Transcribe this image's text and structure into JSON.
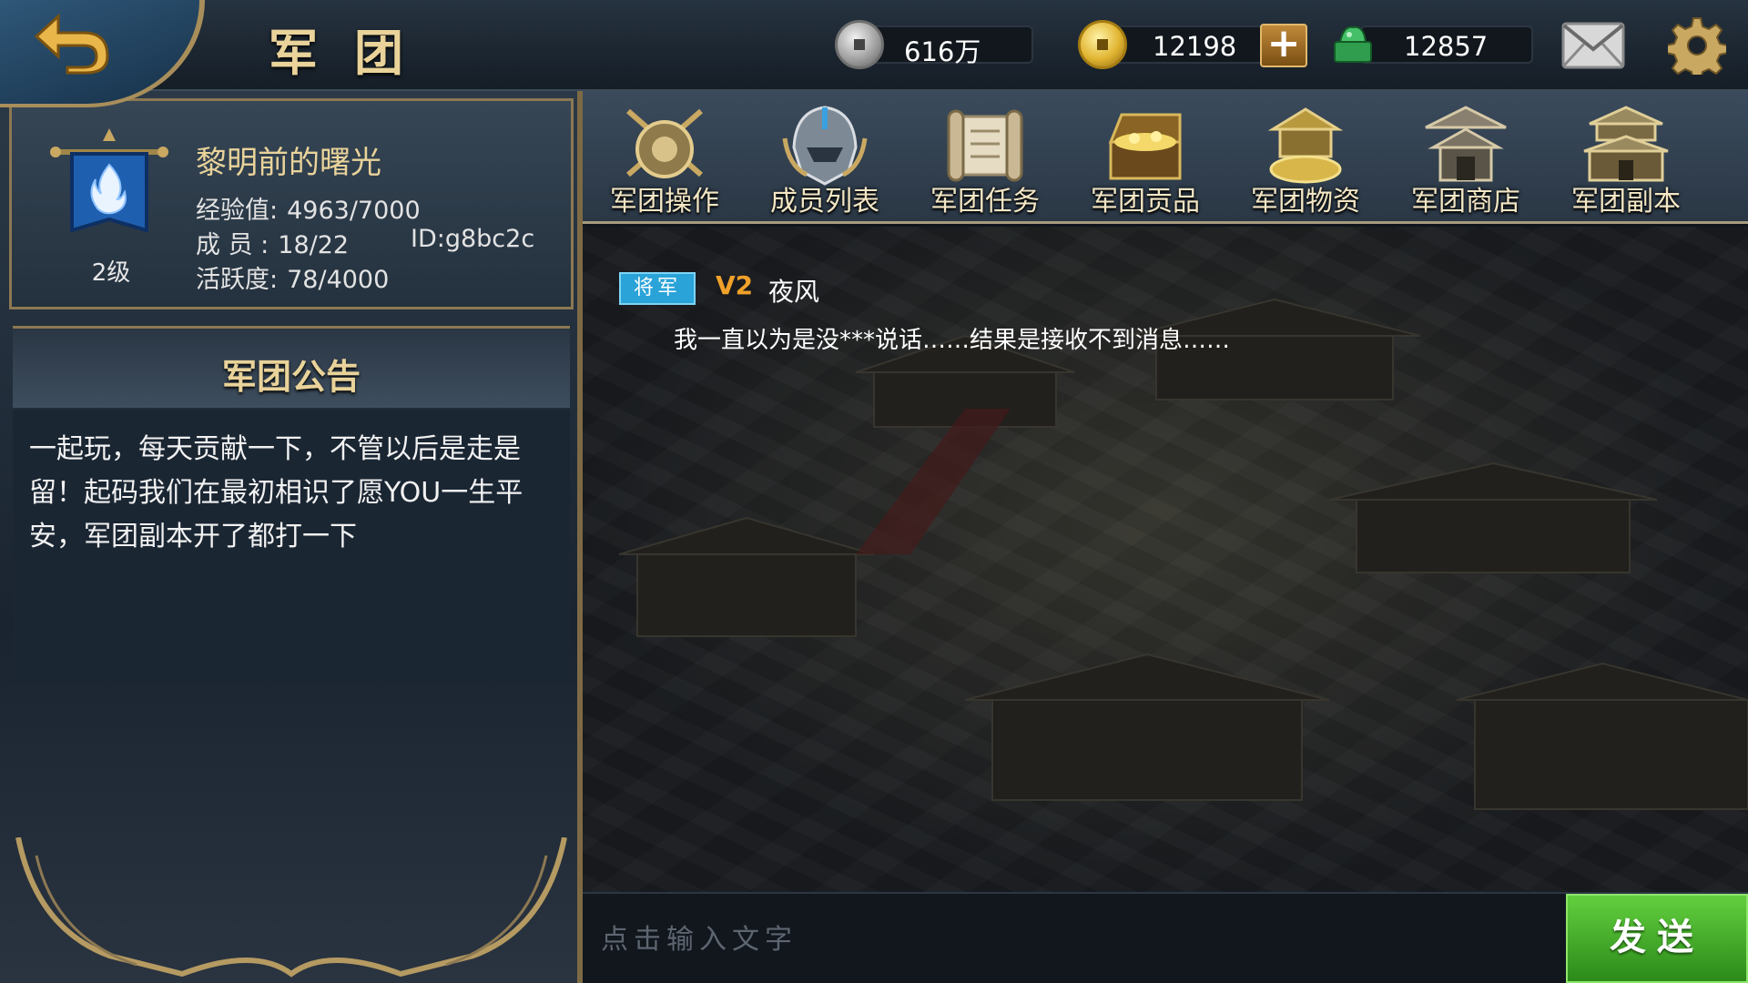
{
  "header": {
    "title": "军团",
    "back_icon": "back-arrow-icon"
  },
  "resources": {
    "silver": "616万",
    "gold": "12198",
    "jade": "12857",
    "add_label": "+"
  },
  "guild": {
    "name": "黎明前的曙光",
    "level": "2级",
    "exp_label": "经验值:",
    "exp_value": "4963/7000",
    "members_label": "成  员 :",
    "members_value": "18/22",
    "id": "ID:g8bc2c",
    "activity_label": "活跃度:",
    "activity_value": "78/4000"
  },
  "notice": {
    "title": "军团公告",
    "text": "一起玩，每天贡献一下，不管以后是走是留！起码我们在最初相识了愿YOU一生平安，军团副本开了都打一下"
  },
  "tabs": [
    {
      "label": "军团操作",
      "icon": "shield-swords-icon"
    },
    {
      "label": "成员列表",
      "icon": "helmet-icon"
    },
    {
      "label": "军团任务",
      "icon": "scroll-icon"
    },
    {
      "label": "军团贡品",
      "icon": "treasure-chest-icon"
    },
    {
      "label": "军团物资",
      "icon": "warehouse-icon"
    },
    {
      "label": "军团商店",
      "icon": "shop-pavilion-icon"
    },
    {
      "label": "军团副本",
      "icon": "palace-icon"
    }
  ],
  "chat": {
    "messages": [
      {
        "rank": "将军",
        "vip": "V2",
        "sender": "夜风",
        "text": "我一直以为是没***说话……结果是接收不到消息……"
      }
    ],
    "input_placeholder": "点击输入文字",
    "send_label": "发送"
  },
  "colors": {
    "gold_text": "#e9d39a",
    "rank_badge": "#2aa3d8",
    "vip": "#f0a12a",
    "send_button": "#4cb52e"
  }
}
